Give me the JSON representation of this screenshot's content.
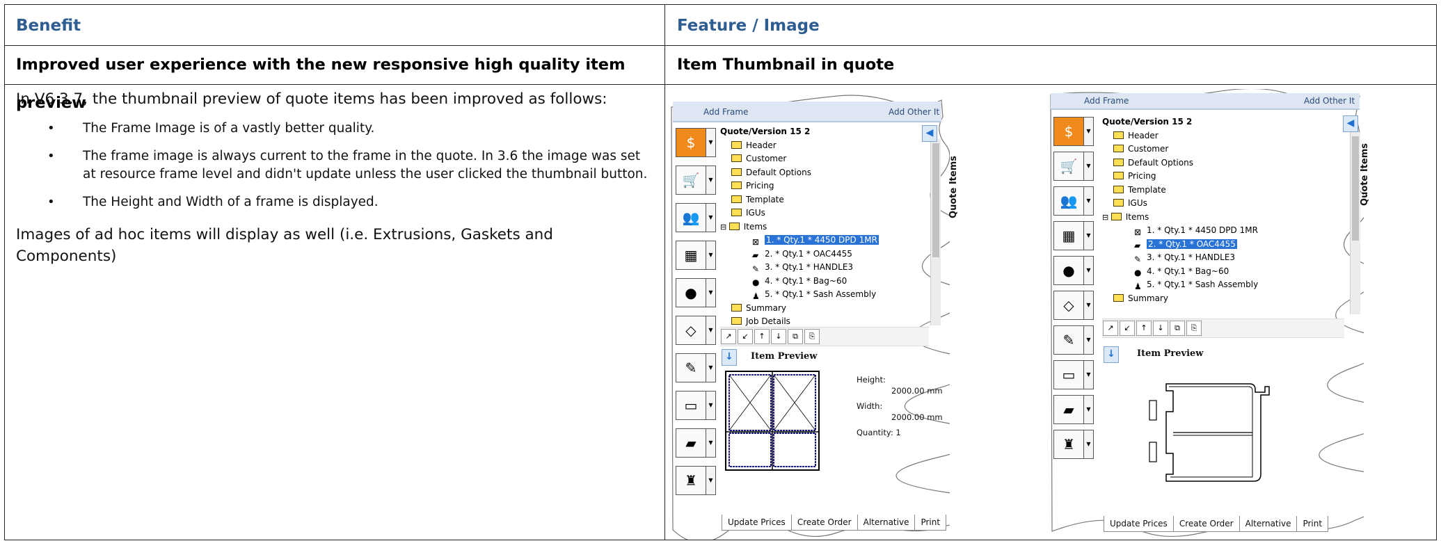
{
  "table": {
    "header_benefit": "Benefit",
    "header_feature": "Feature / Image",
    "row_benefit_title": "Improved user experience with the new responsive high quality item preview",
    "row_feature_title": "Item Thumbnail in quote",
    "intro": "In V6 3.7, the thumbnail preview of quote items has been improved as follows:",
    "bullets": [
      "The Frame Image is of a vastly better quality.",
      "The frame image is always current to the frame in the quote. In 3.6 the image was set at resource frame level and didn't update unless the user clicked the thumbnail button.",
      "The Height and Width of a frame is displayed."
    ],
    "closing": "Images of ad hoc items will display as well (i.e. Extrusions, Gaskets and Components)",
    "bullet_glyph": "•"
  },
  "screenshot_left": {
    "tab_add_frame": "Add Frame",
    "tab_add_other": "Add Other It",
    "root": "Quote/Version 15 2",
    "folders": [
      "Header",
      "Customer",
      "Default Options",
      "Pricing",
      "Template",
      "IGUs",
      "Items"
    ],
    "items": [
      {
        "num": "1.",
        "qty": "Qty.1",
        "name": "4450 DPD 1MR"
      },
      {
        "num": "2.",
        "qty": "Qty.1",
        "name": "OAC4455"
      },
      {
        "num": "3.",
        "qty": "Qty.1",
        "name": "HANDLE3"
      },
      {
        "num": "4.",
        "qty": "Qty.1",
        "name": "Bag~60"
      },
      {
        "num": "5.",
        "qty": "Qty.1",
        "name": "Sash Assembly"
      }
    ],
    "star": "*",
    "after_items": [
      "Summary",
      "Job Details"
    ],
    "selected_index": 0,
    "vertical_tab": "Quote Items",
    "preview_title": "Item Preview",
    "height_label": "Height:",
    "height_value": "2000.00 mm",
    "width_label": "Width:",
    "width_value": "2000.00 mm",
    "quantity_label": "Quantity:",
    "quantity_value": "1",
    "bottom_tabs": [
      "Update Prices",
      "Create Order",
      "Alternative",
      "Print"
    ]
  },
  "screenshot_right": {
    "tab_add_frame": "Add Frame",
    "tab_add_other": "Add Other It",
    "root": "Quote/Version 15 2",
    "folders": [
      "Header",
      "Customer",
      "Default Options",
      "Pricing",
      "Template",
      "IGUs",
      "Items"
    ],
    "items": [
      {
        "num": "1.",
        "qty": "Qty.1",
        "name": "4450 DPD 1MR"
      },
      {
        "num": "2.",
        "qty": "Qty.1",
        "name": "OAC4455"
      },
      {
        "num": "3.",
        "qty": "Qty.1",
        "name": "HANDLE3"
      },
      {
        "num": "4.",
        "qty": "Qty.1",
        "name": "Bag~60"
      },
      {
        "num": "5.",
        "qty": "Qty.1",
        "name": "Sash Assembly"
      }
    ],
    "star": "*",
    "after_items": [
      "Summary"
    ],
    "selected_index": 1,
    "vertical_tab": "Quote Items",
    "preview_title": "Item Preview",
    "bottom_tabs": [
      "Update Prices",
      "Create Order",
      "Alternative",
      "Print"
    ]
  },
  "colors": {
    "header_text": "#2e5d92",
    "selection": "#2a73d6",
    "folder": "#ffdf55",
    "toolbox_orange": "#f08a1c"
  }
}
